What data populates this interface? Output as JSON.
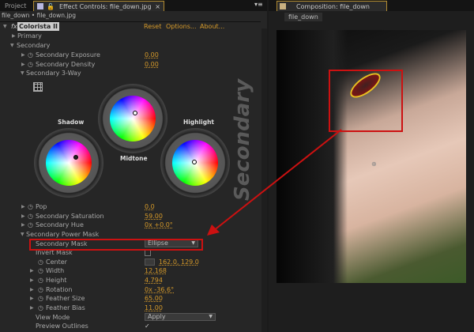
{
  "left_tabs": {
    "project": "Project",
    "effect_controls": "Effect Controls: file_down.jpg"
  },
  "right_tabs": {
    "composition": "Composition: file_down",
    "comp_subtab": "file_down"
  },
  "breadcrumb": "file_down • file_down.jpg",
  "effect": {
    "icon": "fx",
    "name": "Colorista II",
    "reset": "Reset",
    "options": "Options...",
    "about": "About..."
  },
  "groups": {
    "primary": "Primary",
    "secondary": "Secondary",
    "three_way": "Secondary 3-Way",
    "power_mask": "Secondary Power Mask"
  },
  "secondary_params": [
    {
      "label": "Secondary Exposure",
      "value": "0.00"
    },
    {
      "label": "Secondary Density",
      "value": "0.00"
    }
  ],
  "wheels": {
    "shadow": "Shadow",
    "midtone": "Midtone",
    "highlight": "Highlight",
    "vertical_label": "Secondary"
  },
  "color_params": [
    {
      "label": "Pop",
      "value": "0.0"
    },
    {
      "label": "Secondary Saturation",
      "value": "59.00"
    },
    {
      "label": "Secondary Hue",
      "value": "0x +0.0°"
    }
  ],
  "mask": {
    "mask_label": "Secondary Mask",
    "mask_value": "Ellipse",
    "invert_label": "Invert Mask",
    "invert_checked": false,
    "center_label": "Center",
    "center_value": "162.0, 129.0"
  },
  "mask_params": [
    {
      "label": "Width",
      "value": "12.168"
    },
    {
      "label": "Height",
      "value": "4.794"
    },
    {
      "label": "Rotation",
      "value": "0x -36.6°"
    },
    {
      "label": "Feather Size",
      "value": "65.00"
    },
    {
      "label": "Feather Bias",
      "value": "11.00"
    }
  ],
  "view_mode": {
    "label": "View Mode",
    "value": "Apply"
  },
  "preview": {
    "label": "Preview Outlines",
    "checked": true
  },
  "colors": {
    "accent": "#d69a2a",
    "annotation": "#cc1111",
    "tab_highlight": "#b08a30"
  }
}
